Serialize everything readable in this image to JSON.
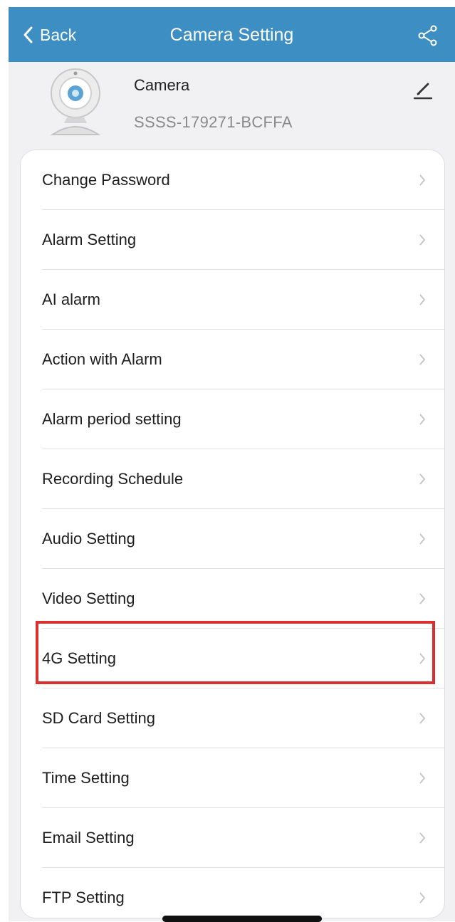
{
  "navbar": {
    "back_label": "Back",
    "title": "Camera Setting",
    "back_icon": "chevron-left-icon",
    "share_icon": "share-icon"
  },
  "camera": {
    "name": "Camera",
    "device_id": "SSSS-179271-BCFFA",
    "avatar_icon": "webcam-icon",
    "edit_icon": "pencil-icon"
  },
  "settings": {
    "items": [
      {
        "label": "Change Password"
      },
      {
        "label": "Alarm Setting"
      },
      {
        "label": "AI alarm"
      },
      {
        "label": "Action with Alarm"
      },
      {
        "label": "Alarm period setting"
      },
      {
        "label": "Recording Schedule"
      },
      {
        "label": "Audio Setting"
      },
      {
        "label": "Video Setting"
      },
      {
        "label": "4G Setting",
        "highlighted": true
      },
      {
        "label": "SD Card Setting"
      },
      {
        "label": "Time Setting"
      },
      {
        "label": "Email Setting"
      },
      {
        "label": "FTP Setting"
      }
    ],
    "chevron_icon": "chevron-right-icon"
  },
  "colors": {
    "navbar": "#3d8fc3",
    "highlight": "#d93030",
    "background": "#f1f1f3"
  }
}
